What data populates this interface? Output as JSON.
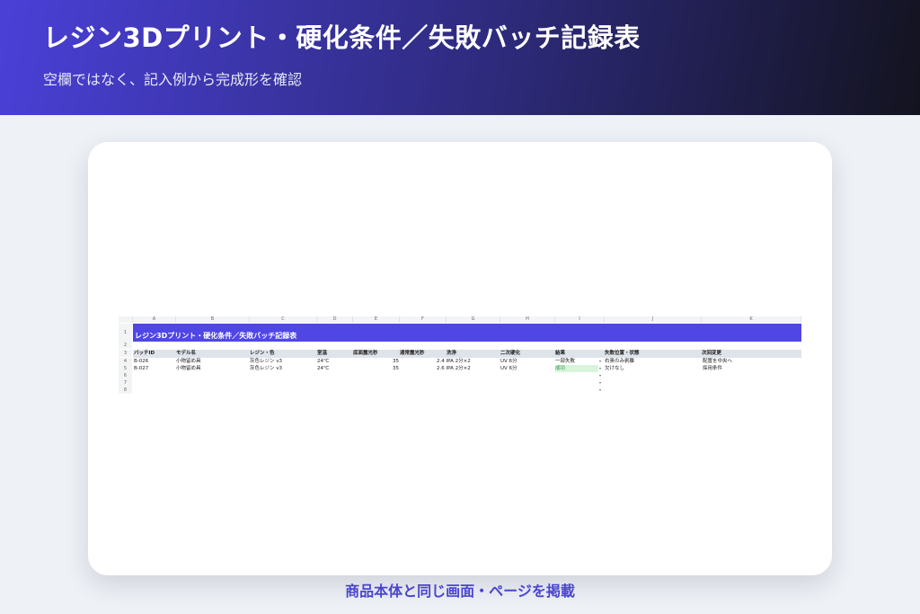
{
  "header": {
    "title": "レジン3Dプリント・硬化条件／失敗バッチ記録表",
    "subtitle": "空欄ではなく、記入例から完成形を確認"
  },
  "sheet": {
    "columns": [
      "A",
      "B",
      "C",
      "D",
      "E",
      "F",
      "G",
      "H",
      "I",
      "J",
      "K"
    ],
    "row_numbers": [
      "1",
      "2",
      "3",
      "4",
      "5",
      "6",
      "7",
      "8"
    ],
    "title": "レジン3Dプリント・硬化条件／失敗バッチ記録表",
    "headers": [
      "バッチID",
      "モデル名",
      "レジン・色",
      "室温",
      "底面露光秒",
      "通常露光秒",
      "洗浄",
      "二次硬化",
      "結果",
      "失敗位置・状態",
      "次回変更"
    ],
    "rows": [
      {
        "batch_id": "B-026",
        "model": "小物留め具",
        "resin": "灰色レジン v3",
        "temp": "24℃",
        "base_exposure": "",
        "normal_exposure": "35",
        "wash": "2.4 IPA 2分×2",
        "post_cure": "UV 6分",
        "result": "一部失敗",
        "failure": "右奥のみ剥離",
        "next_change": "配置を中央へ"
      },
      {
        "batch_id": "B-027",
        "model": "小物留め具",
        "resin": "灰色レジン v3",
        "temp": "24℃",
        "base_exposure": "",
        "normal_exposure": "35",
        "wash": "2.6 IPA 2分×2",
        "post_cure": "UV 6分",
        "result": "成功",
        "failure": "欠けなし",
        "next_change": "採用条件"
      }
    ],
    "dropdown_glyph": "▾"
  },
  "caption": "商品本体と同じ画面・ページを掲載",
  "colors": {
    "accent": "#4f46e5",
    "success_bg": "#d8f5dc",
    "success_text": "#2a8f3c",
    "header_row": "#dfe3ea"
  }
}
